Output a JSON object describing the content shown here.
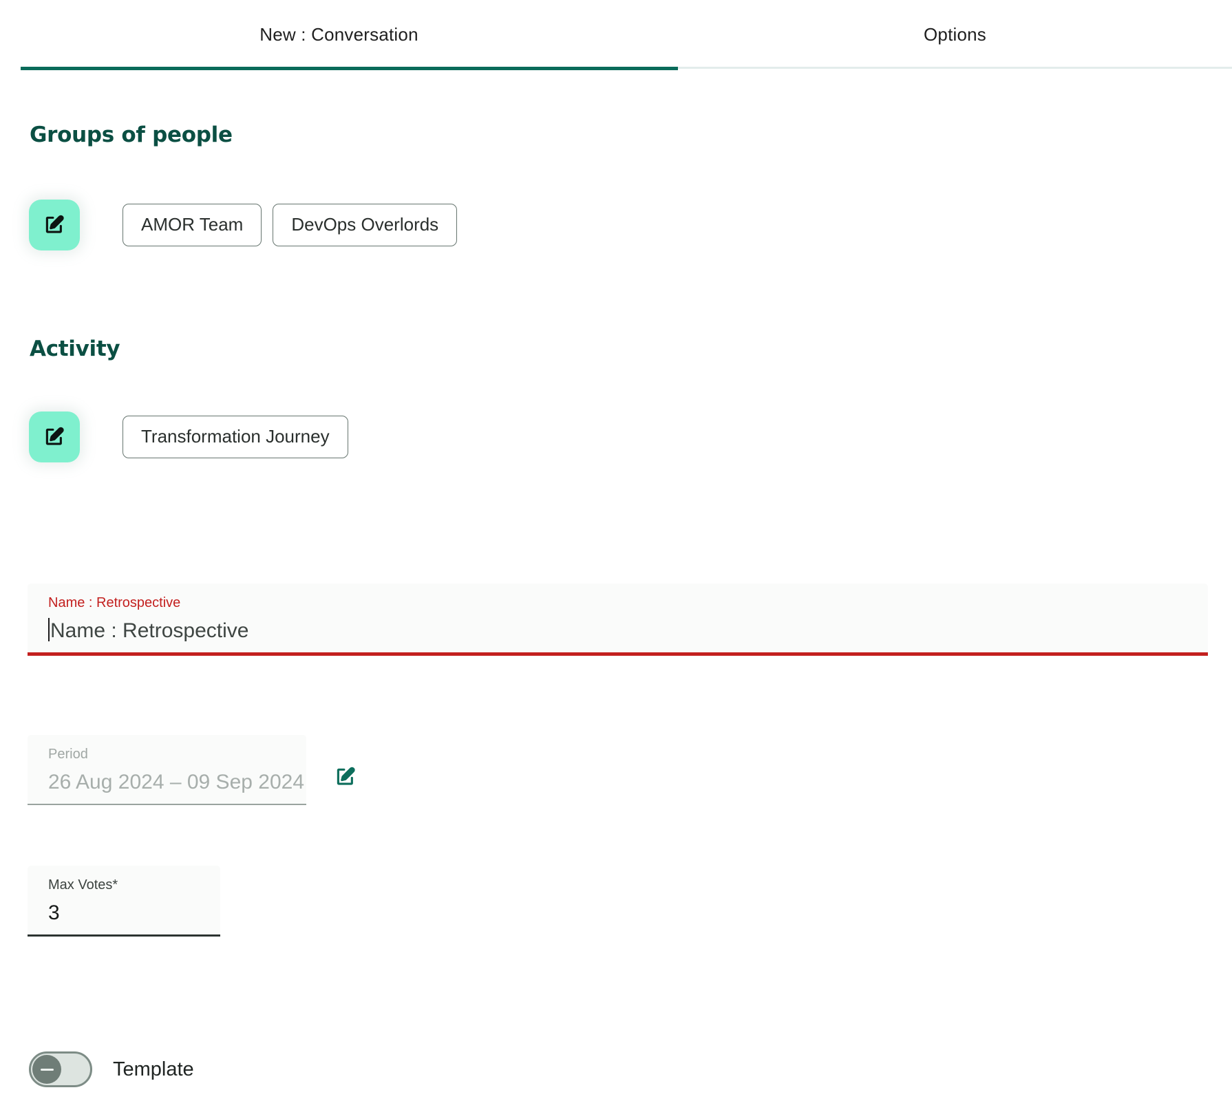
{
  "tabs": [
    {
      "label": "New : Conversation",
      "active": true
    },
    {
      "label": "Options",
      "active": false
    }
  ],
  "sections": {
    "groups": {
      "heading": "Groups of people",
      "edit_icon": "edit-square-pencil-icon",
      "chips": [
        {
          "label": "AMOR Team"
        },
        {
          "label": "DevOps Overlords"
        }
      ]
    },
    "activity": {
      "heading": "Activity",
      "edit_icon": "edit-square-pencil-icon",
      "chips": [
        {
          "label": "Transformation Journey"
        }
      ]
    }
  },
  "fields": {
    "name": {
      "label": "Name : Retrospective",
      "value": "Name : Retrospective",
      "error": true
    },
    "period": {
      "label": "Period",
      "value": "26 Aug 2024 – 09 Sep 2024",
      "disabled": true,
      "edit_icon": "edit-square-pencil-icon"
    },
    "max_votes": {
      "label": "Max Votes*",
      "value": "3"
    }
  },
  "toggle": {
    "label": "Template",
    "state": "off",
    "knob_glyph": "minus-icon"
  },
  "colors": {
    "accent_dark": "#0b4f43",
    "accent_mint": "#7ff0ce",
    "tab_active": "#0a6b5a",
    "error_red": "#c3201f",
    "chip_border": "#66756f",
    "toggle_track": "#dde4e0",
    "toggle_knob": "#6f7d77"
  }
}
